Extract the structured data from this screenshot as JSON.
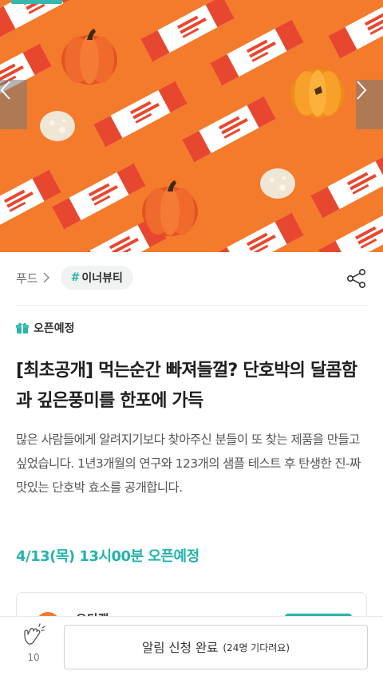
{
  "hero": {
    "product_brand": "MAD PUMPKIN",
    "prev_label": "previous-slide",
    "next_label": "next-slide",
    "colors": {
      "background": "#f37b2b",
      "progress": "#38b8ad"
    }
  },
  "category": {
    "crumb": "푸드",
    "tag_hash": "#",
    "tag_label": "이너뷰티"
  },
  "status": {
    "label": "오픈예정",
    "icon": "gift-icon"
  },
  "title": "[최초공개] 먹는순간 빠져들껄? 단호박의 달콤함과 깊은풍미를 한포에 가득",
  "description": "많은 사람들에게 알려지기보다 찾아주신 분들이 또 찾는 제품을 만들고 싶었습니다. 1년3개월의 연구와 123개의 샘플 테스트 후 탄생한 진-짜 맛있는 단호박 효소를 공개합니다.",
  "open_date": "4/13(목) 13시00분 오픈예정",
  "seller": {
    "name": "오디캠"
  },
  "bottom": {
    "clap_count": "10",
    "notify_label": "알림 신청 완료",
    "notify_sub": "(24명 기다려요)"
  },
  "colors": {
    "accent": "#23b3ab",
    "brand_orange": "#f37b2b"
  }
}
